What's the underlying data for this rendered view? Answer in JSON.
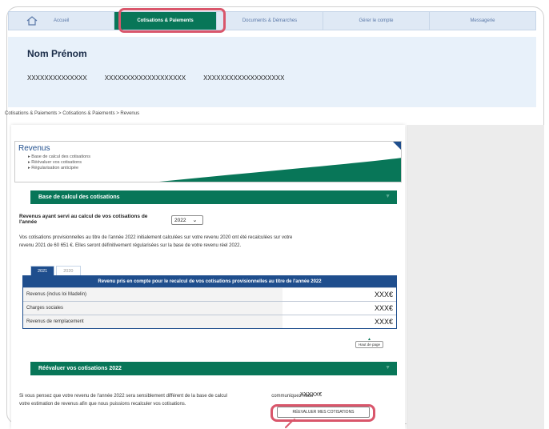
{
  "nav": {
    "items": [
      {
        "label": "Accueil",
        "icon": "home-icon"
      },
      {
        "label": "Cotisations & Paiements",
        "active": true
      },
      {
        "label": "Documents & Démarches"
      },
      {
        "label": "Gérer le compte"
      },
      {
        "label": "Messagerie"
      }
    ]
  },
  "profile": {
    "name": "Nom Prénom",
    "ids": [
      "XXXXXXXXXXXXXX",
      "XXXXXXXXXXXXXXXXXXX",
      "XXXXXXXXXXXXXXXXXXX"
    ]
  },
  "breadcrumb": "Cotisations & Paiements > Cotisations & Paiements > Revenus",
  "revenus": {
    "title": "Revenus",
    "links": [
      "Base de calcul des cotisations",
      "Réévaluer vos cotisations",
      "Régularisation anticipée"
    ]
  },
  "section1": {
    "title": "Base de calcul des cotisations",
    "year_label_line1": "Revenus ayant servi au calcul de vos cotisations de",
    "year_label_line2": "l'année",
    "year_value": "2022",
    "info_line1": "Vos cotisations provisionnelles au titre de l'année 2022 initialement calculées sur votre revenu 2020 ont été recalculées sur votre",
    "info_line2": "revenu 2021 de 60 651 €. Elles seront définitivement régularisées sur la base de votre revenu réel 2022.",
    "tabs": [
      "2021",
      "2020"
    ],
    "table_header": "Revenu pris en compte pour le recalcul de vos cotisations provisionnelles au titre de l'année 2022",
    "rows": [
      {
        "label": "Revenus (inclus loi Madelin)",
        "value": "XXX€"
      },
      {
        "label": "Charges sociales",
        "value": "XXX€"
      },
      {
        "label": "Revenus de remplacement",
        "value": "XXX€"
      }
    ],
    "haut_de_page": "Haut de page"
  },
  "section2": {
    "title": "Réévaluer vos cotisations 2022",
    "text_line1": "Si vous pensez que votre revenu de l'année 2022 sera sensiblement différent de la base de calcul",
    "amount": "XXXXX€",
    "text_line1_end": "communiquez nous",
    "text_line2": "votre estimation de revenus afin que nous puissions recalculer vos cotisations.",
    "button": "RÉEVALUER MES COTISATIONS"
  },
  "colors": {
    "accent": "#087658",
    "blue": "#1f4e8d",
    "highlight": "#d9566b"
  }
}
